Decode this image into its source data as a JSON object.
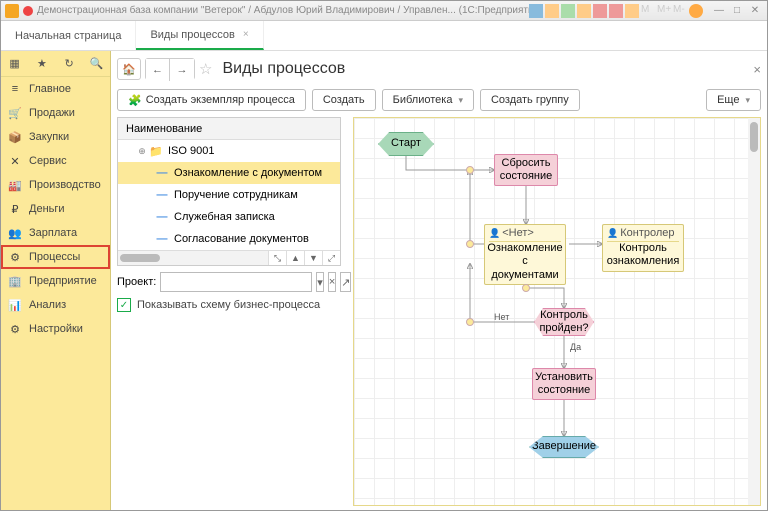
{
  "title": "Демонстрационная база компании \"Ветерок\" / Абдулов Юрий Владимирович / Управлен... (1С:Предприятие)",
  "tabs": {
    "start": "Начальная страница",
    "processes": "Виды процессов"
  },
  "nav": {
    "main": "Главное",
    "sales": "Продажи",
    "purchase": "Закупки",
    "service": "Сервис",
    "production": "Производство",
    "money": "Деньги",
    "salary": "Зарплата",
    "processes": "Процессы",
    "company": "Предприятие",
    "analysis": "Анализ",
    "settings": "Настройки"
  },
  "page": {
    "title": "Виды процессов"
  },
  "toolbar": {
    "createInstance": "Создать экземпляр процесса",
    "create": "Создать",
    "library": "Библиотека",
    "createGroup": "Создать группу",
    "more": "Еще"
  },
  "tree": {
    "header": "Наименование",
    "items": [
      {
        "label": "ISO 9001",
        "folder": true
      },
      {
        "label": "Ознакомление с документом",
        "sel": true
      },
      {
        "label": "Поручение сотрудникам"
      },
      {
        "label": "Служебная записка"
      },
      {
        "label": "Согласование документов"
      }
    ]
  },
  "project": {
    "label": "Проект:"
  },
  "showScheme": "Показывать схему бизнес-процесса",
  "flow": {
    "start": "Старт",
    "reset": "Сбросить состояние",
    "none": "<Нет>",
    "review": "Ознакомление с документами",
    "controller": "Контролер",
    "control": "Контроль ознакомления",
    "passed": "Контроль пройден?",
    "no": "Нет",
    "yes": "Да",
    "set": "Установить состояние",
    "end": "Завершение"
  }
}
